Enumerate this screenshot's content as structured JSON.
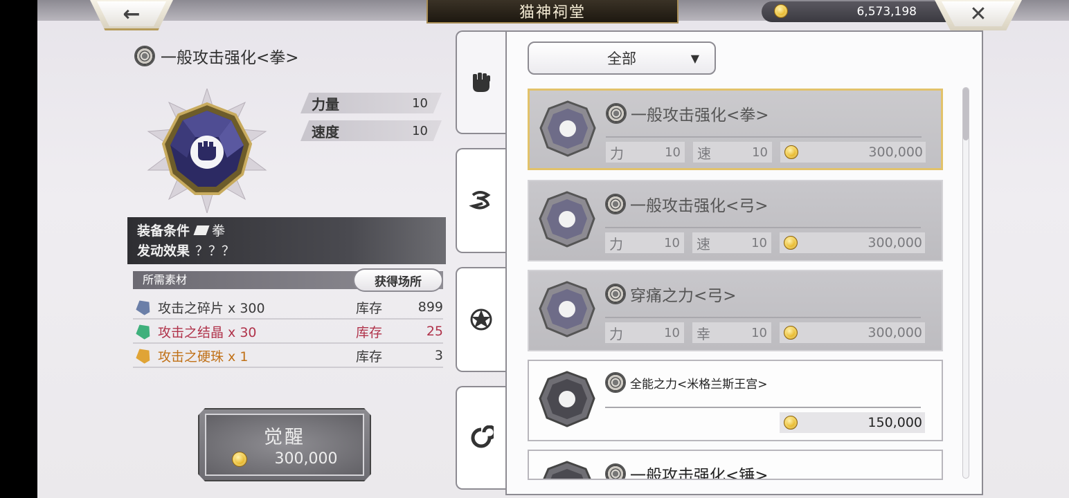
{
  "header": {
    "title": "猫神祠堂",
    "coins": "6,573,198",
    "back_label": "←",
    "close_label": "✕"
  },
  "detail": {
    "name": "一般攻击强化<拳>",
    "stats": [
      {
        "label": "力量",
        "value": "10"
      },
      {
        "label": "速度",
        "value": "10"
      }
    ],
    "equip_label": "装备条件",
    "equip_value": "拳",
    "effect_label": "发动效果",
    "effect_value": "？？？",
    "materials_header": "所需素材",
    "obtain_button": "获得场所",
    "materials": [
      {
        "name": "攻击之碎片 x 300",
        "stock_label": "库存",
        "count": "899",
        "color": "#3a3a3a",
        "icon_color": "#6b7fa8"
      },
      {
        "name": "攻击之结晶 x 30",
        "stock_label": "库存",
        "count": "25",
        "color": "#b0324a",
        "icon_color": "#3fb07c"
      },
      {
        "name": "攻击之硬珠 x 1",
        "stock_label": "库存",
        "count": "3",
        "color": "#c07016",
        "icon_color": "#e0a436"
      }
    ],
    "awaken_label": "觉醒",
    "awaken_cost": "300,000"
  },
  "list": {
    "filter_label": "全部",
    "filter_arrow": "▼",
    "tabs": [
      "fist-tab-icon",
      "bow-tab-icon",
      "star-tab-icon",
      "swirl-tab-icon"
    ],
    "items": [
      {
        "name": "一般攻击强化<拳>",
        "s1_label": "力",
        "s1_value": "10",
        "s2_label": "速",
        "s2_value": "10",
        "price": "300,000"
      },
      {
        "name": "一般攻击强化<弓>",
        "s1_label": "力",
        "s1_value": "10",
        "s2_label": "速",
        "s2_value": "10",
        "price": "300,000"
      },
      {
        "name": "穿痛之力<弓>",
        "s1_label": "力",
        "s1_value": "10",
        "s2_label": "幸",
        "s2_value": "10",
        "price": "300,000"
      },
      {
        "name": "全能之力<米格兰斯王宫>",
        "price": "150,000"
      },
      {
        "name": "一般攻击强化<锤>"
      }
    ]
  }
}
